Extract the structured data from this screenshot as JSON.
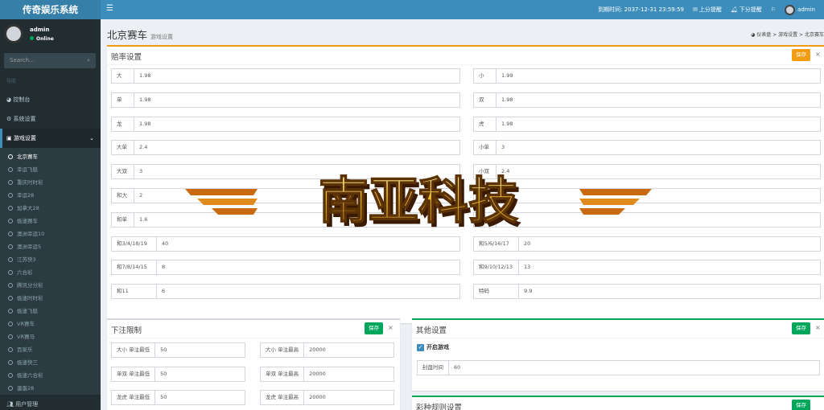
{
  "app": {
    "title": "传奇娱乐系统"
  },
  "topbar": {
    "menu_icon": "bars-icon",
    "expire": "到期时间: 2037-12-31 23:59:59",
    "up": "上分提醒",
    "down": "下分提醒",
    "user": "admin"
  },
  "sidebar": {
    "user": {
      "name": "admin",
      "status": "Online"
    },
    "search": {
      "placeholder": "Search..."
    },
    "nav_header": "导航",
    "menu": [
      {
        "label": "控制台",
        "icon": "dashboard-icon"
      },
      {
        "label": "系统设置",
        "icon": "cogs-icon"
      },
      {
        "label": "游戏设置",
        "icon": "gamepad-icon"
      }
    ],
    "games": [
      "北京赛车",
      "幸运飞艇",
      "重庆时时彩",
      "幸运28",
      "加拿大28",
      "极速赛车",
      "澳洲幸运10",
      "澳洲幸运5",
      "江苏快3",
      "六合彩",
      "腾讯分分彩",
      "极速时时彩",
      "极速飞艇",
      "VR赛车",
      "VR赛马",
      "百家乐",
      "极速快三",
      "极速六合彩",
      "蛋蛋28"
    ],
    "bottom": "用户管理"
  },
  "page": {
    "title": "北京赛车",
    "subtitle": "游戏设置",
    "breadcrumb": [
      "仪表盘",
      "游戏设置",
      "北京赛车"
    ]
  },
  "odds": {
    "title": "赔率设置",
    "save": "保存",
    "left": [
      {
        "label": "大",
        "value": "1.98"
      },
      {
        "label": "单",
        "value": "1.98"
      },
      {
        "label": "龙",
        "value": "1.98"
      },
      {
        "label": "大单",
        "value": "2.4"
      },
      {
        "label": "大双",
        "value": "3"
      },
      {
        "label": "和大",
        "value": "2"
      },
      {
        "label": "和单",
        "value": "1.6"
      },
      {
        "label": "和3/4/18/19",
        "value": "40"
      },
      {
        "label": "和7/8/14/15",
        "value": "8"
      },
      {
        "label": "和11",
        "value": "6"
      }
    ],
    "right": [
      {
        "label": "小",
        "value": "1.99"
      },
      {
        "label": "双",
        "value": "1.98"
      },
      {
        "label": "虎",
        "value": "1.98"
      },
      {
        "label": "小单",
        "value": "3"
      },
      {
        "label": "小双",
        "value": "2.4"
      },
      {
        "label": "和小",
        "value": ""
      },
      {
        "label": "和双",
        "value": ""
      },
      {
        "label": "和5/6/16/17",
        "value": "20"
      },
      {
        "label": "和9/10/12/13",
        "value": "13"
      },
      {
        "label": "特码",
        "value": "9.9"
      }
    ]
  },
  "limits": {
    "title": "下注限制",
    "save": "保存",
    "left": [
      {
        "label": "大小 单注最低",
        "value": "50"
      },
      {
        "label": "单双 单注最低",
        "value": "50"
      },
      {
        "label": "龙虎 单注最低",
        "value": "50"
      }
    ],
    "right": [
      {
        "label": "大小 单注最高",
        "value": "20000"
      },
      {
        "label": "单双 单注最高",
        "value": "20000"
      },
      {
        "label": "龙虎 单注最高",
        "value": "20000"
      }
    ]
  },
  "other": {
    "title": "其他设置",
    "save": "保存",
    "open_game": "开启游戏",
    "close_label": "封盘时间",
    "close_value": "60"
  },
  "rules": {
    "title": "彩种规则设置",
    "save": "保存"
  },
  "watermark": {
    "text": "南亚科技"
  }
}
